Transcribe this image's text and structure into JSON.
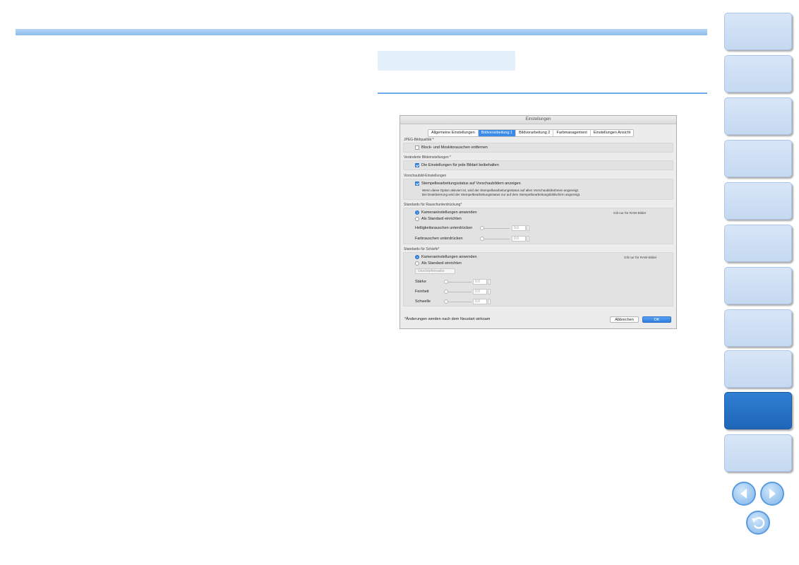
{
  "page": {
    "colors": {
      "accent_bar": "#8ebfee",
      "section_line": "#6ba9e8",
      "side_tab": "#c5d9f1",
      "side_tab_active": "#1f66b8"
    }
  },
  "side_tabs": {
    "count": 11,
    "active_index": 9
  },
  "nav": {
    "prev_icon": "arrow-left-icon",
    "next_icon": "arrow-right-icon",
    "back_icon": "return-icon"
  },
  "dialog": {
    "title": "Einstellungen",
    "tabs": [
      "Allgemeine Einstellungen",
      "Bildverarbeitung 1",
      "Bildverarbeitung 2",
      "Farbmanagement",
      "Einstellungen Ansicht"
    ],
    "selected_tab": "Bildverarbeitung 1",
    "jpeg": {
      "label": "JPEG-Bildqualität *",
      "checkbox_label": "Block- und Moskitorauschen entfernen",
      "checked": false
    },
    "changed": {
      "label": "Veränderte Bildeinstellungen *",
      "checkbox_label": "Die Einstellungen für jede Bildart beibehalten",
      "checked": true
    },
    "preview": {
      "label": "Vorschaubild-Einstellungen",
      "checkbox_label": "Stempelbearbeitungsstatus auf Vorschaubildern anzeigen",
      "checked": true,
      "note_line1": "Wenn diese Option aktiviert ist, wird der Stempelbearbeitungsstatus auf allen Vorschaubildrahmen angezeigt.",
      "note_line2": "Bei Deaktivierung wird der Stempelbearbeitungsstatus nur auf dem Stempelbearbeitungsbildschirm angezeigt."
    },
    "noise": {
      "label": "Standards für Rauschunterdrückung*",
      "raw_note": "Gilt nur für RAW-Bilder",
      "radio1": "Kameraeinstellungen anwenden",
      "radio2": "Als Standard einrichten",
      "selected_radio": 1,
      "luma_label": "Helligkeitsrauschen unterdrücken",
      "luma_value": "0.0",
      "chroma_label": "Farbrauschen unterdrücken",
      "chroma_value": "0.0"
    },
    "sharpness": {
      "label": "Standards für Schärfe*",
      "raw_note": "Gilt nur für RAW-Bilder",
      "radio1": "Kameraeinstellungen anwenden",
      "radio2": "Als Standard einrichten",
      "selected_radio": 1,
      "select_value": "Unschärfemaske",
      "strength_label": "Stärke",
      "strength_value": "0.0",
      "fineness_label": "Feinheit",
      "fineness_value": "0.0",
      "threshold_label": "Schwelle",
      "threshold_value": "0.0"
    },
    "footnote": "*Änderungen werden nach dem Neustart wirksam",
    "cancel_label": "Abbrechen",
    "ok_label": "OK"
  }
}
